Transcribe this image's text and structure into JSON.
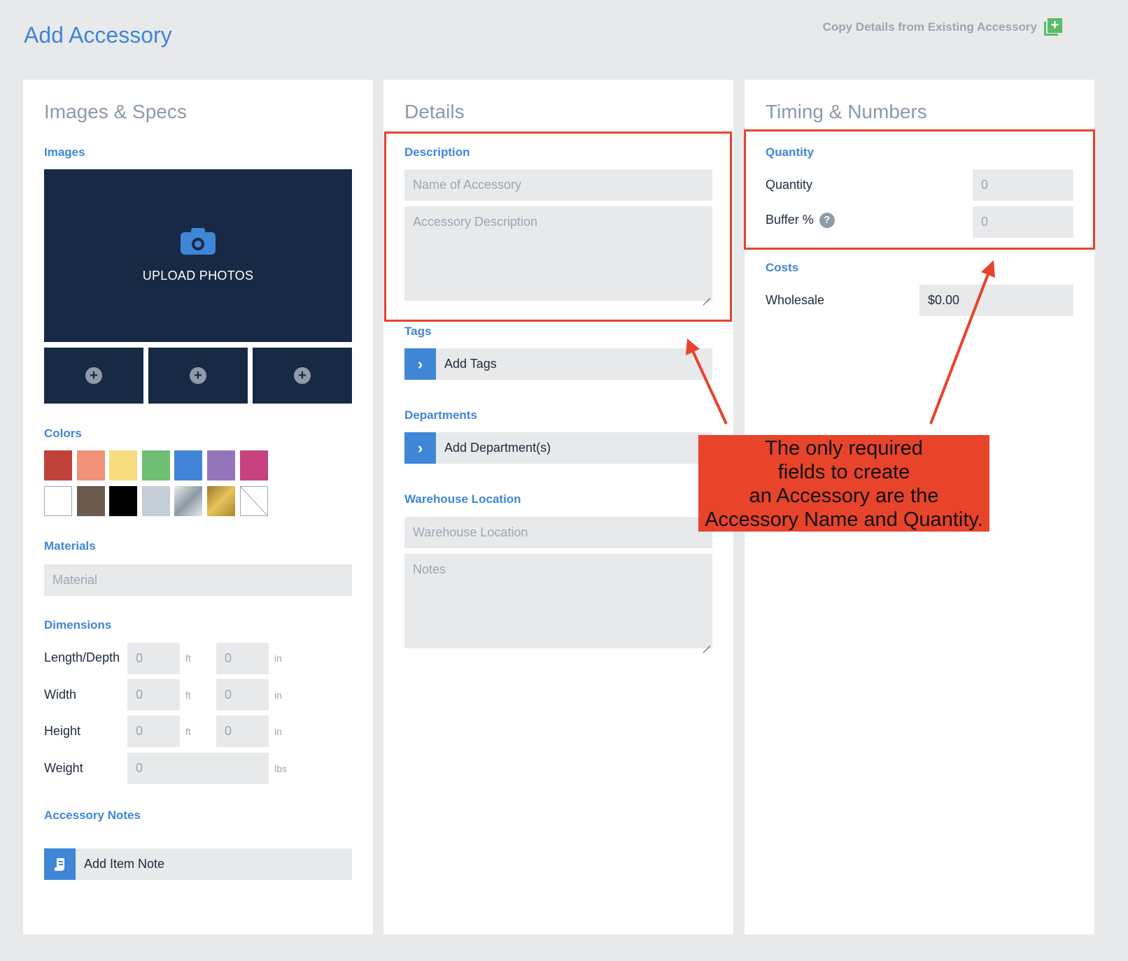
{
  "page": {
    "title": "Add Accessory"
  },
  "header": {
    "copy_link": "Copy Details from Existing Accessory"
  },
  "images_specs": {
    "title": "Images & Specs",
    "images_label": "Images",
    "upload_text": "UPLOAD PHOTOS",
    "thumb_plus": "+",
    "colors_label": "Colors",
    "colors": [
      "#c0413a",
      "#f0917a",
      "#f8dd7f",
      "#6fbe74",
      "#4184d8",
      "#9575ba",
      "#c7427f",
      "#ffffff",
      "#6b5a4e",
      "#000000",
      "#c5ced6",
      "silver-gradient",
      "gold-gradient",
      "none"
    ],
    "materials_label": "Materials",
    "material_placeholder": "Material",
    "dimensions_label": "Dimensions",
    "dimensions": [
      {
        "label": "Length/Depth",
        "ft": "0",
        "ft_unit": "ft",
        "in": "0",
        "in_unit": "in"
      },
      {
        "label": "Width",
        "ft": "0",
        "ft_unit": "ft",
        "in": "0",
        "in_unit": "in"
      },
      {
        "label": "Height",
        "ft": "0",
        "ft_unit": "ft",
        "in": "0",
        "in_unit": "in"
      }
    ],
    "weight": {
      "label": "Weight",
      "value": "0",
      "unit": "lbs"
    },
    "notes_label": "Accessory Notes",
    "add_note": "Add Item Note"
  },
  "details": {
    "title": "Details",
    "description_label": "Description",
    "name_placeholder": "Name of Accessory",
    "description_placeholder": "Accessory Description",
    "tags_label": "Tags",
    "add_tags": "Add Tags",
    "departments_label": "Departments",
    "add_departments": "Add Department(s)",
    "warehouse_label": "Warehouse Location",
    "warehouse_placeholder": "Warehouse Location",
    "notes_placeholder": "Notes"
  },
  "timing": {
    "title": "Timing & Numbers",
    "quantity_label": "Quantity",
    "quantity_row": "Quantity",
    "quantity_value": "0",
    "buffer_row": "Buffer %",
    "buffer_value": "0",
    "costs_label": "Costs",
    "wholesale_row": "Wholesale",
    "wholesale_value": "$0.00"
  },
  "annotation": {
    "line1": "The only required",
    "line2": "fields to create",
    "line3": "an Accessory are the",
    "line4": "Accessory Name and Quantity.",
    "color": "#e8432b"
  }
}
